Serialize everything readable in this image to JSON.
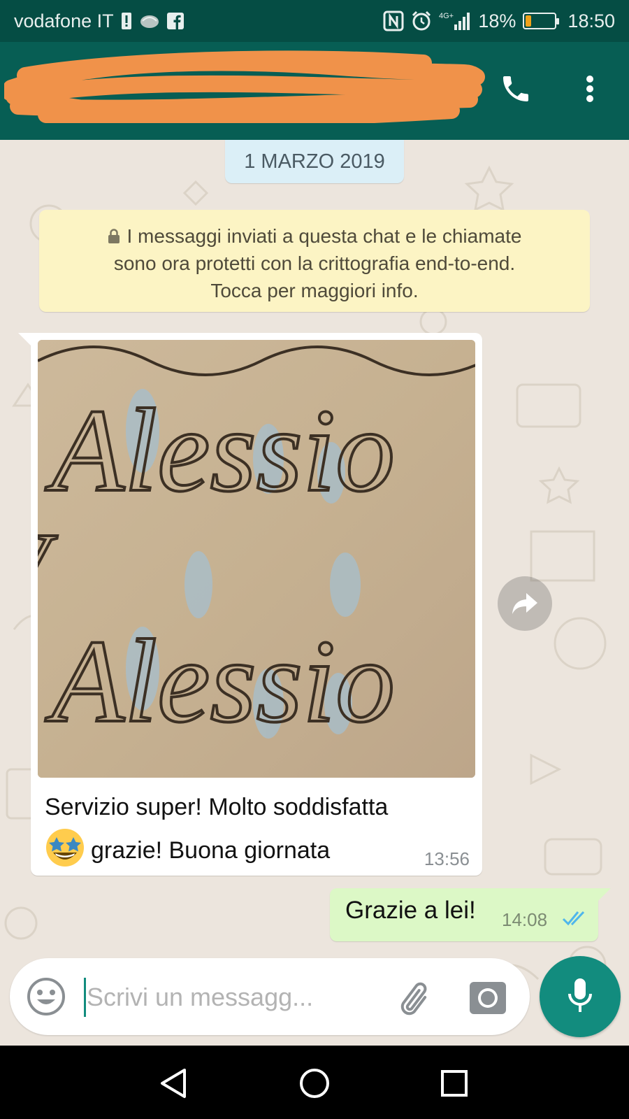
{
  "status_bar": {
    "carrier": "vodafone IT",
    "network": "4G+",
    "battery_percent": "18%",
    "battery_level": 0.18,
    "time": "18:50"
  },
  "header": {
    "contact_redacted": true,
    "icons": [
      "back-arrow-icon",
      "avatar",
      "video-call-icon",
      "phone-icon",
      "more-vert-icon"
    ]
  },
  "chat": {
    "date_divider": "1 MARZO 2019",
    "encryption_notice": {
      "line1": "I messaggi inviati a questa chat e le chiamate",
      "line2": "sono ora protetti con la crittografia end-to-end.",
      "line3": "Tocca per maggiori info."
    },
    "messages": [
      {
        "direction": "incoming",
        "type": "image",
        "image_text": "Alessio",
        "caption_line1": "Servizio super! Molto soddisfatta",
        "emoji": "star-struck",
        "caption_line2": "grazie! Buona giornata",
        "time": "13:56"
      },
      {
        "direction": "outgoing",
        "text": "Grazie a lei!",
        "time": "14:08",
        "status": "read"
      }
    ]
  },
  "composer": {
    "placeholder": "Scrivi un messagg..."
  },
  "colors": {
    "header": "#075e54",
    "status_bar": "#054d44",
    "chat_bg": "#ece5dd",
    "outgoing_bubble": "#dcf8c6",
    "notice_bg": "#fcf4c4",
    "accent": "#128c7e",
    "read_ticks": "#4fb6ec"
  }
}
